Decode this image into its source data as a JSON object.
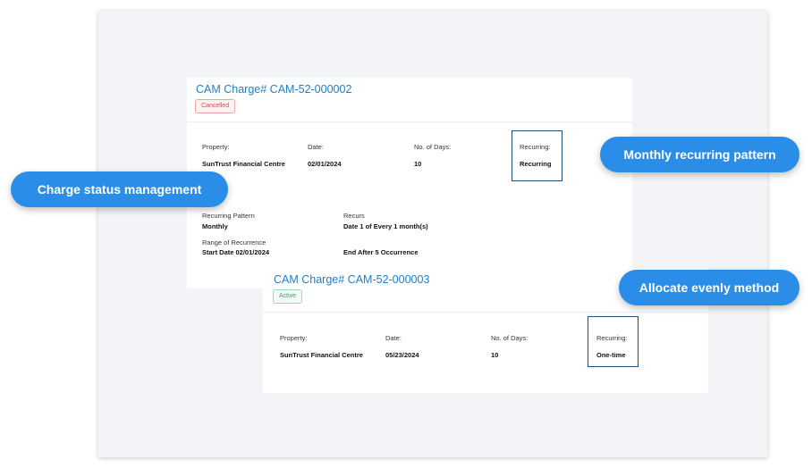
{
  "charges": [
    {
      "title": "CAM Charge# CAM-52-000002",
      "status": "Cancelled",
      "property_label": "Property:",
      "property_value": "SunTrust Financial Centre",
      "date_label": "Date:",
      "date_value": "02/01/2024",
      "days_label": "No. of Days:",
      "days_value": "10",
      "recurring_label": "Recurring:",
      "recurring_value": "Recurring",
      "recurring_pattern_label": "Recurring Pattern",
      "recurring_pattern_value": "Monthly",
      "recurs_label": "Recurs",
      "recurs_value": "Date 1 of Every 1 month(s)",
      "range_label": "Range of Recurrence",
      "range_start": "Start Date 02/01/2024",
      "range_end": "End After 5 Occurrence"
    },
    {
      "title": "CAM Charge# CAM-52-000003",
      "status": "Active",
      "property_label": "Property:",
      "property_value": "SunTrust Financial Centre",
      "date_label": "Date:",
      "date_value": "05/23/2024",
      "days_label": "No. of Days:",
      "days_value": "10",
      "recurring_label": "Recurring:",
      "recurring_value": "One-time"
    }
  ],
  "callouts": {
    "status_management": "Charge status management",
    "monthly_pattern": "Monthly recurring pattern",
    "allocate_evenly": "Allocate evenly method"
  },
  "colors": {
    "accent": "#2a8ee8",
    "title_link": "#1e7fc9",
    "cancelled": "#d9464c",
    "active": "#3aa06b",
    "highlight_border": "#1f4e7a"
  }
}
